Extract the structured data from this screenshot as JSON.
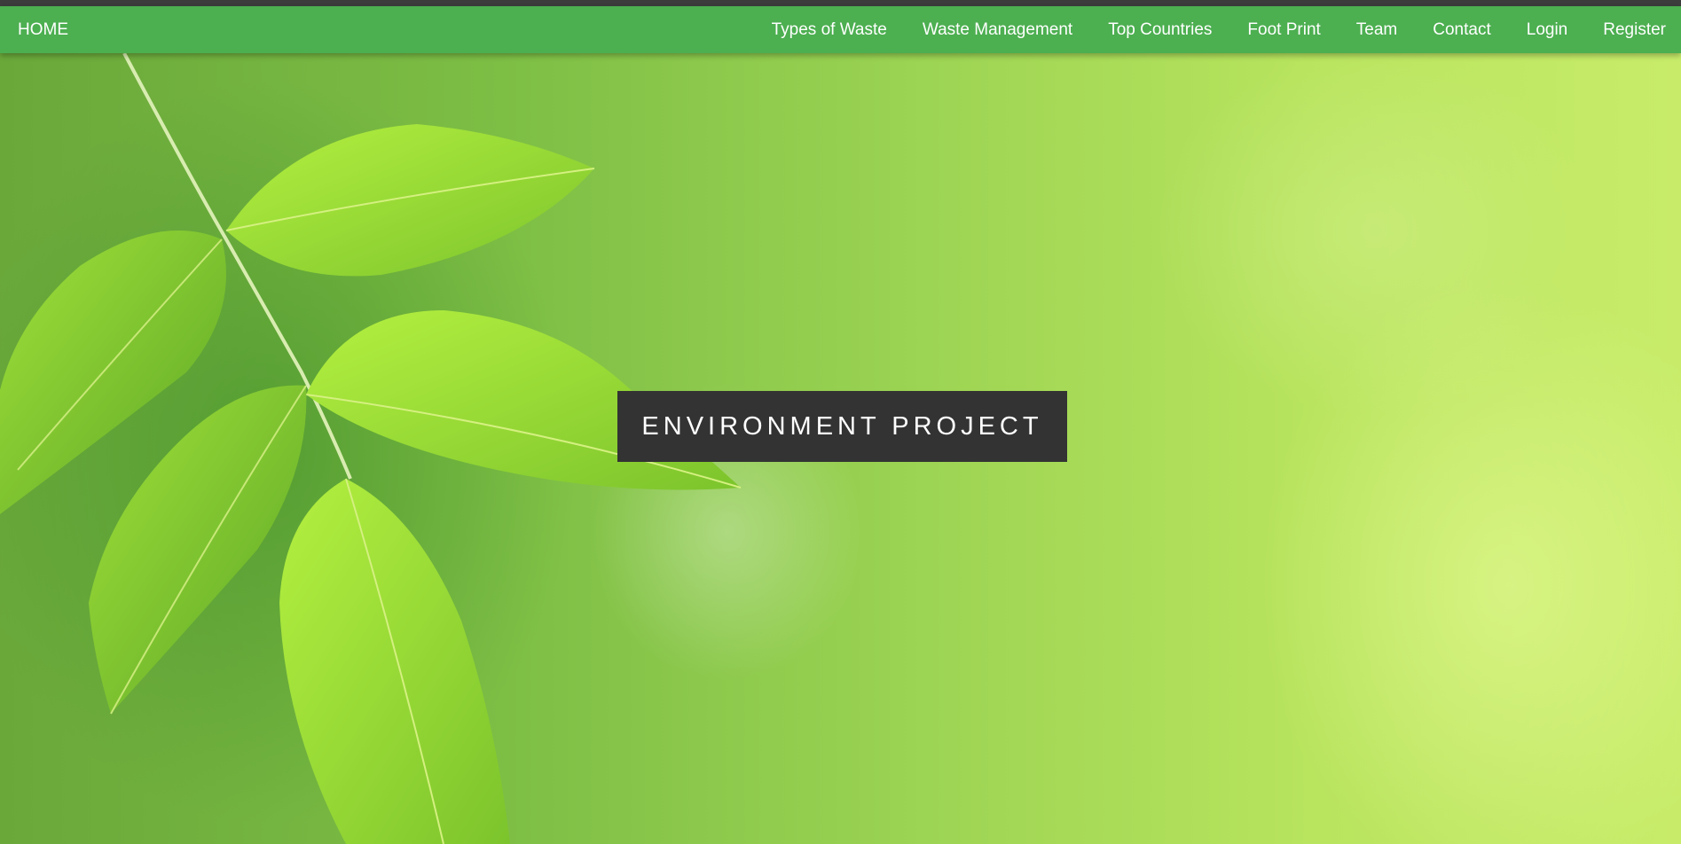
{
  "nav": {
    "home_label": "HOME",
    "links": [
      {
        "label": "Types of Waste"
      },
      {
        "label": "Waste Management"
      },
      {
        "label": "Top Countries"
      },
      {
        "label": "Foot Print"
      },
      {
        "label": "Team"
      },
      {
        "label": "Contact"
      },
      {
        "label": "Login"
      },
      {
        "label": "Register"
      }
    ]
  },
  "hero": {
    "title": "ENVIRONMENT PROJECT",
    "background_image": "green-leaves-branch"
  },
  "colors": {
    "navbar": "#4caf50",
    "top_strip": "#3c3c3c",
    "title_box": "#333333",
    "text": "#ffffff"
  }
}
